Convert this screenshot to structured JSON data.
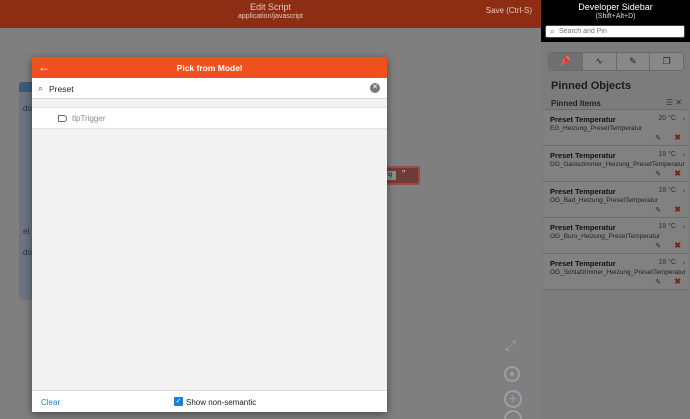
{
  "topbar": {
    "title": "Edit Script",
    "subtitle": "application/javascript",
    "save": "Save (Ctrl-S)"
  },
  "canvas": {
    "block_text_1": "do",
    "block_text_2": "el",
    "block_text_3": "do",
    "red_block_input": "ng",
    "red_block_quote": "”"
  },
  "sidebar": {
    "title": "Developer Sidebar",
    "shortcut": "(Shift+Alt+D)",
    "search_placeholder": "Search and Pin",
    "section_title": "Pinned Objects",
    "pinned_label": "Pinned Items",
    "items": [
      {
        "name": "Preset Temperatur",
        "value": "20 °C",
        "item": "EG_Heizung_PresetTemperatur"
      },
      {
        "name": "Preset Temperatur",
        "value": "18 °C",
        "item": "DG_Gastezimmer_Heizung_PresetTemperatur"
      },
      {
        "name": "Preset Temperatur",
        "value": "18 °C",
        "item": "OG_Bad_Heizung_PresetTemperatur"
      },
      {
        "name": "Preset Temperatur",
        "value": "18 °C",
        "item": "OG_Buro_Heizung_PresetTemperatur"
      },
      {
        "name": "Preset Temperatur",
        "value": "18 °C",
        "item": "OG_Schlafzimmer_Heizung_PresetTemperatur"
      }
    ]
  },
  "modal": {
    "title": "Pick from Model",
    "search_value": "Preset",
    "result": "tlpTrigger",
    "clear": "Clear",
    "show_non_semantic": "Show non-semantic",
    "show_non_semantic_checked": true
  },
  "colors": {
    "accent": "#ef521e",
    "link": "#1e7fd0",
    "topbar_dimmed": "#8d2e14"
  }
}
